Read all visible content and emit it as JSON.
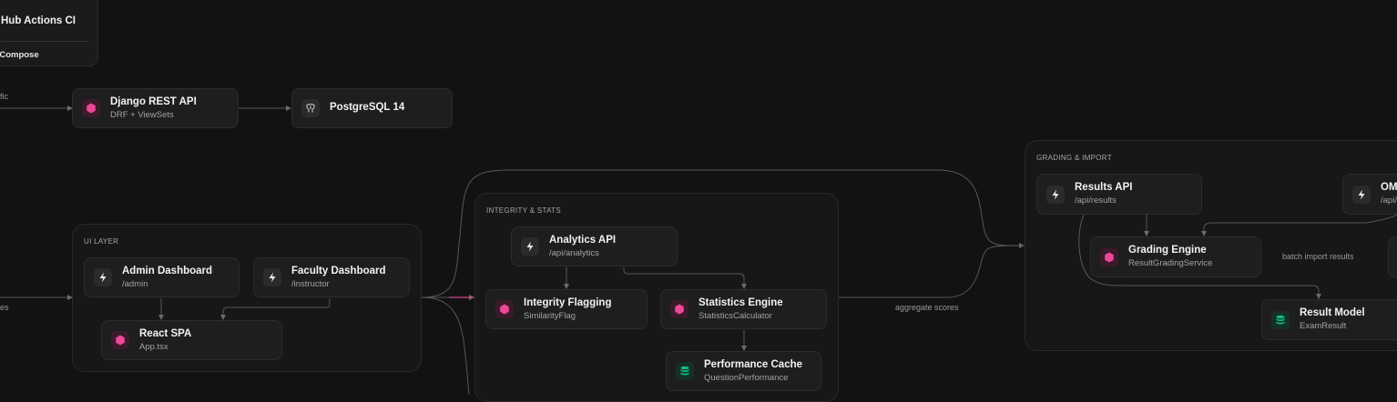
{
  "top_card": {
    "title": "Hub Actions CI",
    "subtitle": "r Compose"
  },
  "groups": {
    "ui": {
      "title": "UI LAYER"
    },
    "integrity": {
      "title": "INTEGRITY & STATS"
    },
    "grading": {
      "title": "GRADING & IMPORT"
    }
  },
  "nodes": {
    "django_api": {
      "title": "Django REST API",
      "subtitle": "DRF + ViewSets",
      "icon": "hexagon-icon"
    },
    "postgres": {
      "title": "PostgreSQL 14",
      "icon": "elephant-icon"
    },
    "admin_dashboard": {
      "title": "Admin Dashboard",
      "subtitle": "/admin",
      "icon": "bolt-icon"
    },
    "faculty_dashboard": {
      "title": "Faculty Dashboard",
      "subtitle": "/instructor",
      "icon": "bolt-icon"
    },
    "react_spa": {
      "title": "React SPA",
      "subtitle": "App.tsx",
      "icon": "hexagon-icon"
    },
    "analytics_api": {
      "title": "Analytics API",
      "subtitle": "/api/analytics",
      "icon": "bolt-icon"
    },
    "integrity_flagging": {
      "title": "Integrity Flagging",
      "subtitle": "SimilarityFlag",
      "icon": "hexagon-icon"
    },
    "statistics_engine": {
      "title": "Statistics Engine",
      "subtitle": "StatisticsCalculator",
      "icon": "hexagon-icon"
    },
    "performance_cache": {
      "title": "Performance Cache",
      "subtitle": "QuestionPerformance",
      "icon": "database-icon"
    },
    "results_api": {
      "title": "Results API",
      "subtitle": "/api/results",
      "icon": "bolt-icon"
    },
    "omr_api": {
      "title": "OM",
      "subtitle": "/api/",
      "icon": "bolt-icon"
    },
    "grading_engine": {
      "title": "Grading Engine",
      "subtitle": "ResultGradingService",
      "icon": "hexagon-icon"
    },
    "result_model": {
      "title": "Result Model",
      "subtitle": "ExamResult",
      "icon": "database-icon"
    }
  },
  "edge_labels": {
    "traffic": "fic",
    "routes": "es",
    "aggregate_scores": "aggregate scores",
    "batch_import": "batch import results"
  },
  "colors": {
    "background": "#121212",
    "node": "#1e1e1e",
    "group": "#171717",
    "accent_pink": "#ec4899",
    "accent_green": "#10b981",
    "edge": "#5a5a5a"
  }
}
